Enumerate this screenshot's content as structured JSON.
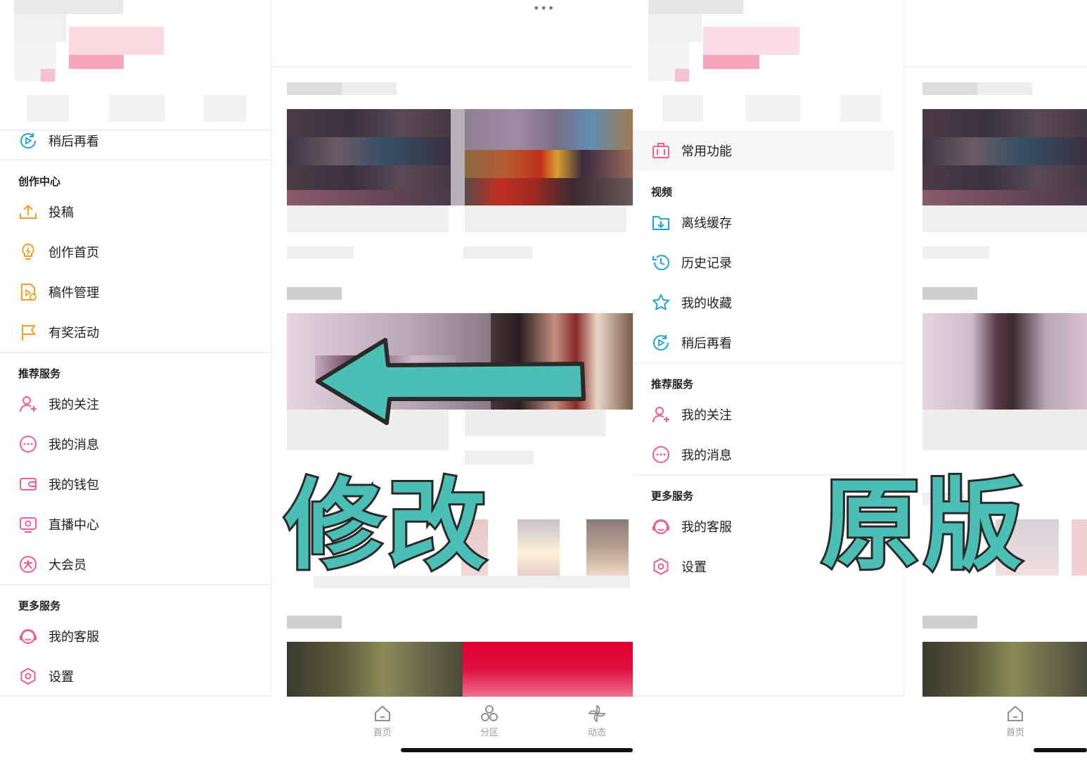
{
  "colors": {
    "accent_blue": "#1fa4e0",
    "accent_orange": "#f0a020",
    "accent_pink": "#f25d8e",
    "arrow": "#4bbfb5",
    "arrow_stroke": "#2a2a2a"
  },
  "left": {
    "menu_dots": "•••",
    "watch_later": "稍后再看",
    "creation": {
      "title": "创作中心",
      "items": [
        "投稿",
        "创作首页",
        "稿件管理",
        "有奖活动"
      ]
    },
    "recommended": {
      "title": "推荐服务",
      "items": [
        "我的关注",
        "我的消息",
        "我的钱包",
        "直播中心",
        "大会员"
      ]
    },
    "more": {
      "title": "更多服务",
      "items": [
        "我的客服",
        "设置"
      ]
    }
  },
  "right": {
    "common": "常用功能",
    "video": {
      "title": "视频",
      "items": [
        "离线缓存",
        "历史记录",
        "我的收藏",
        "稍后再看"
      ]
    },
    "recommended": {
      "title": "推荐服务",
      "items": [
        "我的关注",
        "我的消息"
      ]
    },
    "more": {
      "title": "更多服务",
      "items": [
        "我的客服",
        "设置"
      ]
    }
  },
  "tabs_left": [
    "首页",
    "分区",
    "动态"
  ],
  "tabs_right": [
    "首页"
  ],
  "overlay": {
    "modified": "修改",
    "original": "原版"
  }
}
